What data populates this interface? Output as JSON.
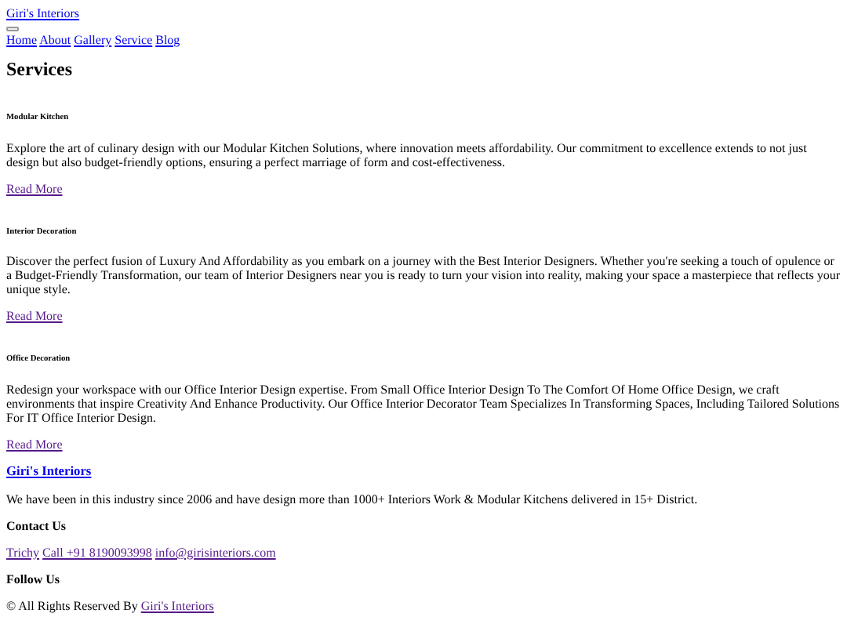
{
  "header": {
    "logo": {
      "text": "Giri's Interiors",
      "visited": false
    },
    "nav": [
      {
        "label": "Home",
        "visited": false
      },
      {
        "label": "About",
        "visited": false
      },
      {
        "label": "Gallery",
        "visited": false
      },
      {
        "label": "Service",
        "visited": false
      },
      {
        "label": "Blog",
        "visited": false
      }
    ]
  },
  "heading": "Services",
  "services": [
    {
      "title": "Modular Kitchen",
      "description": "Explore the art of culinary design with our Modular Kitchen Solutions, where innovation meets affordability. Our commitment to excellence extends to not just design but also budget-friendly options, ensuring a perfect marriage of form and cost-effectiveness.",
      "link": {
        "text": "Read More",
        "visited": true
      }
    },
    {
      "title": "Interior Decoration",
      "description": "Discover the perfect fusion of Luxury And Affordability as you embark on a journey with the Best Interior Designers. Whether you're seeking a touch of opulence or a Budget-Friendly Transformation, our team of Interior Designers near you is ready to turn your vision into reality, making your space a masterpiece that reflects your unique style.",
      "link": {
        "text": "Read More",
        "visited": true
      }
    },
    {
      "title": "Office Decoration",
      "description": "Redesign your workspace with our Office Interior Design expertise. From Small Office Interior Design To The Comfort Of Home Office Design, we craft environments that inspire Creativity And Enhance Productivity. Our Office Interior Decorator Team Specializes In Transforming Spaces, Including Tailored Solutions For IT Office Interior Design.",
      "link": {
        "text": "Read More",
        "visited": true
      }
    }
  ],
  "footer": {
    "brand": {
      "text": "Giri's Interiors",
      "visited": false
    },
    "about": "We have been in this industry since 2006 and have design more than 1000+ Interiors Work & Modular Kitchens delivered in 15+ District.",
    "contact_heading": "Contact Us",
    "contact_links": [
      {
        "text": "Trichy",
        "visited": true
      },
      {
        "text": "Call +91 8190093998",
        "visited": true
      },
      {
        "text": "info@girisinteriors.com",
        "visited": true
      }
    ],
    "follow_heading": "Follow Us",
    "copyright": "© All Rights Reserved By",
    "copyright_link": {
      "text": "Giri's Interiors",
      "visited": true
    }
  }
}
